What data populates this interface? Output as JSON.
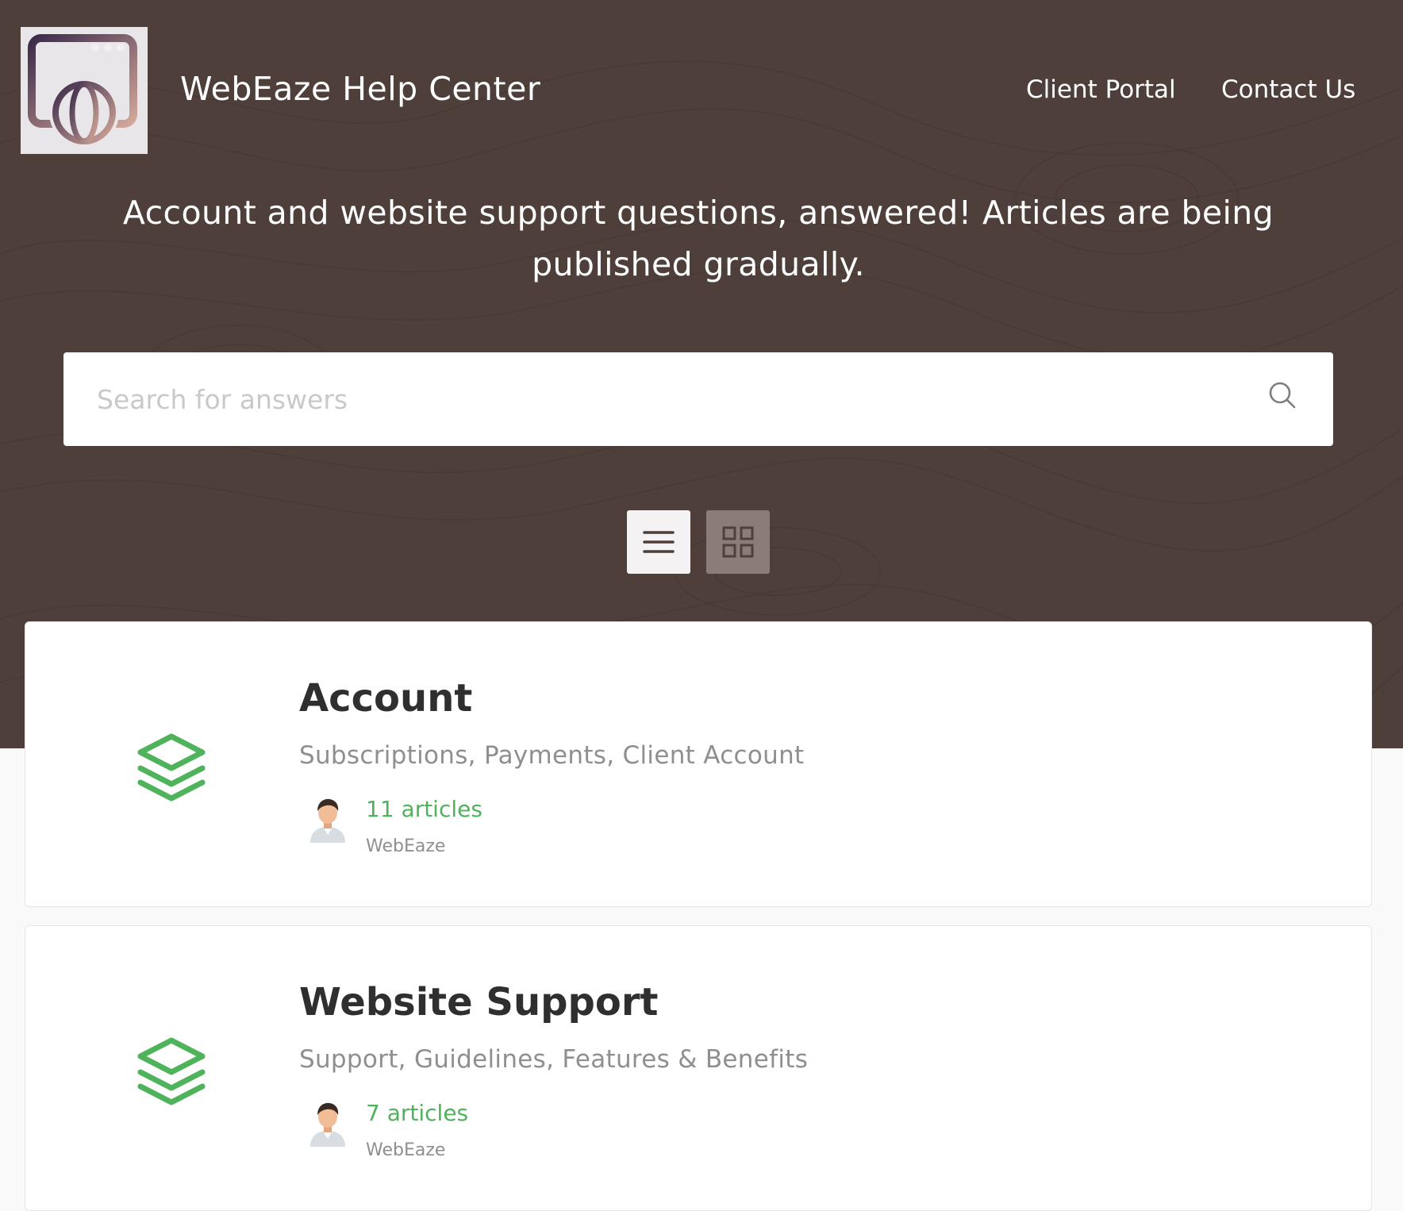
{
  "header": {
    "brand_title": "WebEaze Help Center",
    "nav": {
      "client_portal": "Client Portal",
      "contact_us": "Contact Us"
    }
  },
  "hero": {
    "tagline": "Account and website support questions, answered! Articles are being published gradually."
  },
  "search": {
    "value": "",
    "placeholder": "Search for answers",
    "icon": "search-icon"
  },
  "view_toggle": {
    "selected": "list",
    "options": [
      "list",
      "grid"
    ]
  },
  "categories": [
    {
      "title": "Account",
      "description": "Subscriptions, Payments, Client Account",
      "article_count": "11 articles",
      "author": "WebEaze",
      "icon": "layers-icon"
    },
    {
      "title": "Website Support",
      "description": "Support, Guidelines, Features & Benefits",
      "article_count": "7 articles",
      "author": "WebEaze",
      "icon": "layers-icon"
    }
  ],
  "colors": {
    "hero_background": "#4f3f3a",
    "accent_green": "#4fb35c",
    "page_background": "#f9f9f9",
    "title_text": "#2f2f2f",
    "muted_text": "#8f8f8f"
  }
}
